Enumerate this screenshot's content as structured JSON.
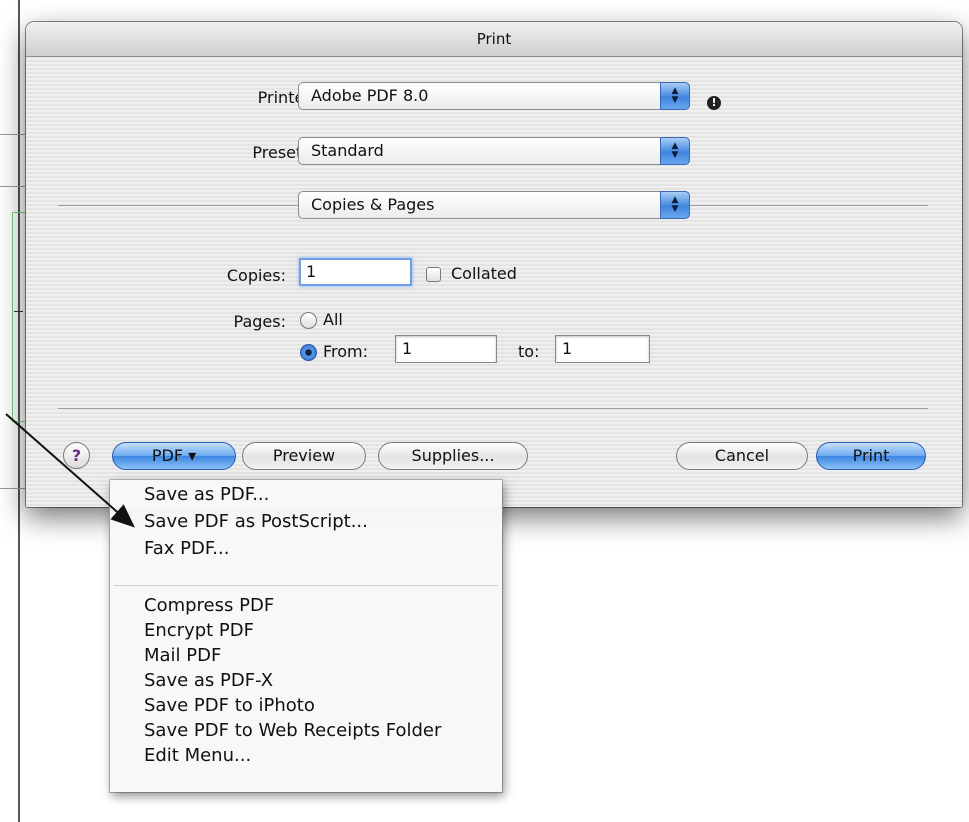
{
  "dialog": {
    "title": "Print",
    "printer_label": "Printer:",
    "printer_value": "Adobe PDF 8.0",
    "presets_label": "Presets:",
    "presets_value": "Standard",
    "panel_value": "Copies & Pages",
    "copies_label": "Copies:",
    "copies_value": "1",
    "collated_label": "Collated",
    "pages_label": "Pages:",
    "all_label": "All",
    "from_label": "From:",
    "from_value": "1",
    "to_label": "to:",
    "to_value": "1",
    "buttons": {
      "help": "?",
      "pdf": "PDF ▾",
      "preview": "Preview",
      "supplies": "Supplies...",
      "cancel": "Cancel",
      "print": "Print"
    }
  },
  "pdf_menu": {
    "items": [
      "Save as PDF...",
      "Save PDF as PostScript...",
      "Fax PDF...",
      "Compress PDF",
      "Encrypt PDF",
      "Mail PDF",
      "Save as PDF-X",
      "Save PDF to iPhoto",
      "Save PDF to Web Receipts Folder",
      "Edit Menu..."
    ]
  },
  "icons": {
    "stepper": "up-down-arrows-icon",
    "info": "info-icon",
    "arrow": "annotation-arrow"
  },
  "colors": {
    "accent_blue": "#3c86e3",
    "dialog_bg": "#ececec"
  }
}
